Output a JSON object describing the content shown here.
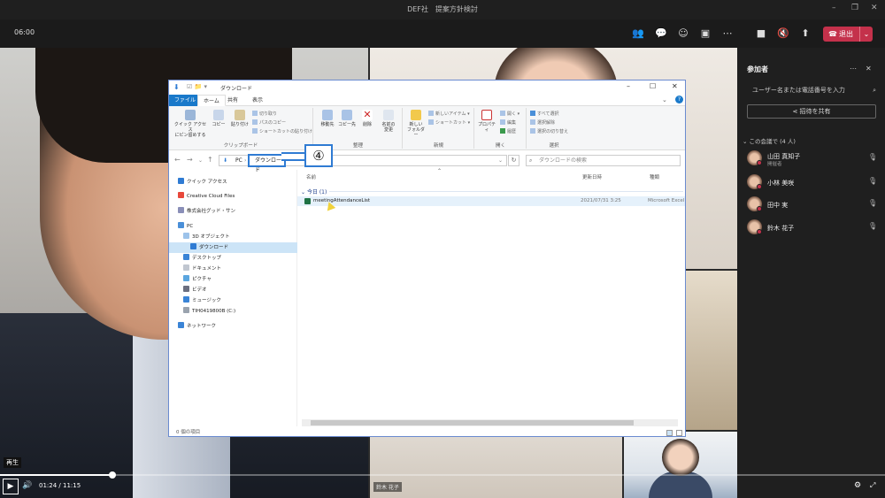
{
  "window": {
    "title": "DEF社　提案方針検討"
  },
  "meeting": {
    "elapsed": "06:00",
    "leave_label": "退出",
    "icons": [
      "participants-icon",
      "chat-icon",
      "reactions-icon",
      "rooms-icon",
      "more-icon",
      "camera-icon",
      "mute-icon",
      "share-icon"
    ]
  },
  "explorer": {
    "title": "ダウンロード",
    "tabs": [
      "ファイル",
      "ホーム",
      "共有",
      "表示"
    ],
    "ribbon": {
      "clipboard": {
        "label": "クリップボード",
        "pin": "クイック アクセス\nにピン留めする",
        "copy": "コピー",
        "paste": "貼り付け",
        "cut": "切り取り",
        "copy_path": "パスのコピー",
        "paste_shortcut": "ショートカットの貼り付け"
      },
      "organize": {
        "label": "整理",
        "move_to": "移動先",
        "copy_to": "コピー先",
        "delete": "削除",
        "rename": "名前の\n変更"
      },
      "new": {
        "label": "新規",
        "new_folder": "新しい\nフォルダー",
        "new_item": "新しいアイテム",
        "shortcut": "ショートカット"
      },
      "open": {
        "label": "開く",
        "properties": "プロパティ",
        "open": "開く",
        "edit": "編集",
        "history": "履歴"
      },
      "select": {
        "label": "選択",
        "select_all": "すべて選択",
        "select_none": "選択解除",
        "invert": "選択の切り替え"
      }
    },
    "address": {
      "pc": "PC",
      "current": "ダウンロード"
    },
    "search_placeholder": "ダウンロードの検索",
    "nav": [
      "クイック アクセス",
      "Creative Cloud Files",
      "株式会社グッド・サン",
      "PC",
      "3D オブジェクト",
      "ダウンロード",
      "デスクトップ",
      "ドキュメント",
      "ピクチャ",
      "ビデオ",
      "ミュージック",
      "TIH0419800B (C:)",
      "ネットワーク"
    ],
    "columns": {
      "name": "名前",
      "modified": "更新日時",
      "type": "種類"
    },
    "group": "今日 (1)",
    "file": {
      "name": "meetingAttendanceList",
      "date": "2021/07/31 3:25",
      "type": "Microsoft Excel"
    },
    "status": "0 個の項目"
  },
  "callout": {
    "label": "④"
  },
  "participants": {
    "title": "参加者",
    "search_placeholder": "ユーザー名または電話番号を入力",
    "share_label": "招待を共有",
    "section": "この会議で (4 人)",
    "people": [
      {
        "name": "山田 真知子",
        "role": "開催者"
      },
      {
        "name": "小林 美咲",
        "role": ""
      },
      {
        "name": "田中 実",
        "role": ""
      },
      {
        "name": "鈴木 花子",
        "role": ""
      }
    ]
  },
  "video_tile_name": "鈴木 花子",
  "player": {
    "tooltip": "再生",
    "current": "01:24",
    "separator": "/",
    "duration": "11:15",
    "progress": 0.127
  }
}
